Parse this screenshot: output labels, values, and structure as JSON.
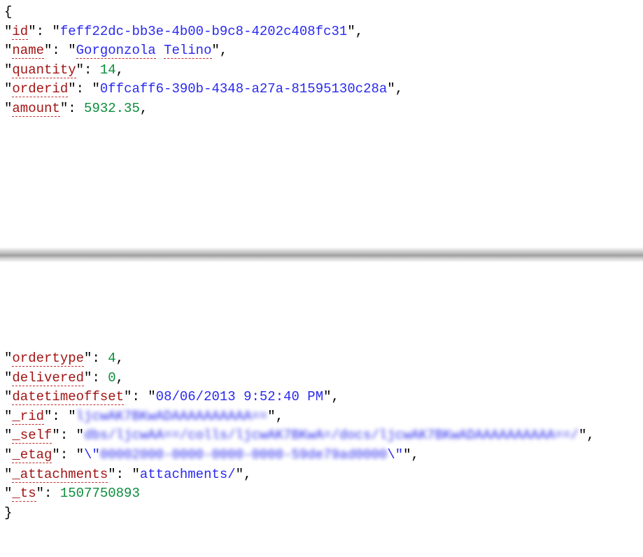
{
  "top": {
    "id_key": "id",
    "id_val": "feff22dc-bb3e-4b00-b9c8-4202c408fc31",
    "name_key": "name",
    "name_val1": "Gorgonzola",
    "name_val2": "Telino",
    "quantity_key": "quantity",
    "quantity_val": "14",
    "orderid_key": "orderid",
    "orderid_val": "0ffcaff6-390b-4348-a27a-81595130c28a",
    "amount_key": "amount",
    "amount_val": "5932.35"
  },
  "bottom": {
    "ordertype_key": "ordertype",
    "ordertype_val": "4",
    "delivered_key": "delivered",
    "delivered_val": "0",
    "datetimeoffset_key": "datetimeoffset",
    "datetimeoffset_val": "08/06/2013 9:52:40 PM",
    "rid_key": "_rid",
    "rid_val": "ljcwAK7BKwADAAAAAAAAAA==",
    "self_key": "_self",
    "self_val": "dbs/ljcwAA==/colls/ljcwAK7BKwA=/docs/ljcwAK7BKwADAAAAAAAAAA==/",
    "etag_key": "_etag",
    "etag_val_prefix": "\\\"",
    "etag_val_blur": "00002000-0000-0000-0000-59de79ad0000",
    "etag_val_suffix": "\\\"",
    "attachments_key": "_attachments",
    "attachments_val": "attachments/",
    "ts_key": "_ts",
    "ts_val": "1507750893"
  }
}
